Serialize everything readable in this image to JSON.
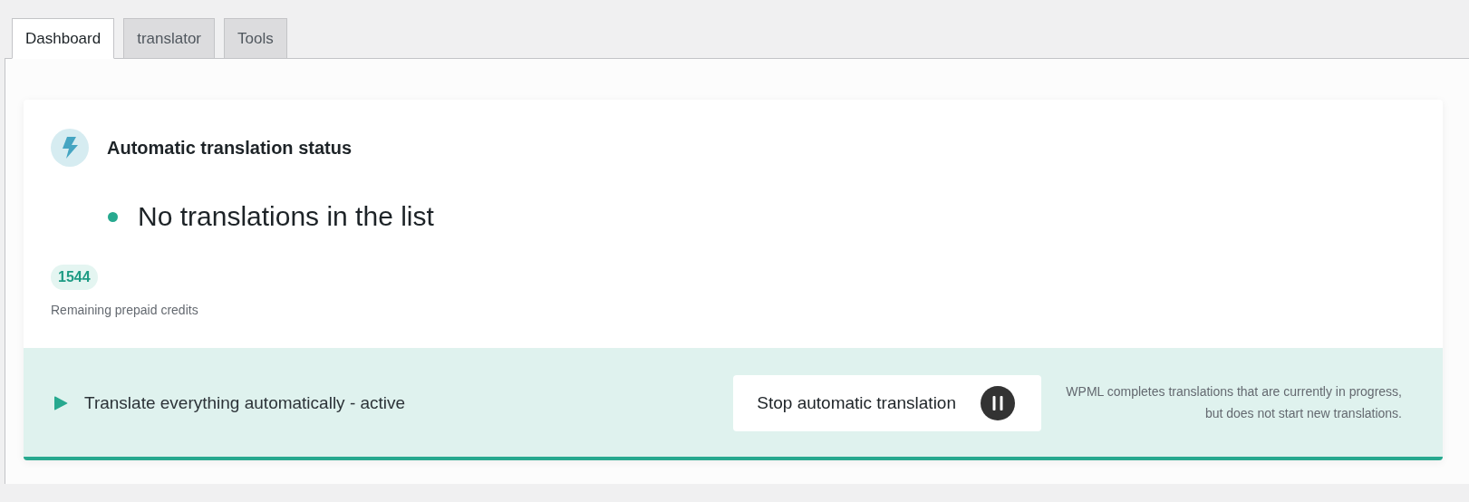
{
  "tabs": [
    {
      "label": "Dashboard",
      "selected": true
    },
    {
      "label": "translator",
      "selected": false
    },
    {
      "label": "Tools",
      "selected": false
    }
  ],
  "status_card": {
    "title": "Automatic translation status",
    "status": "No translations in the list",
    "credits": {
      "count": "1544",
      "label": "Remaining prepaid credits"
    },
    "footer": {
      "mode": "Translate everything automatically - active",
      "button": "Stop automatic translation",
      "note": "WPML completes translations that are currently in progress, but does not start new translations."
    }
  }
}
